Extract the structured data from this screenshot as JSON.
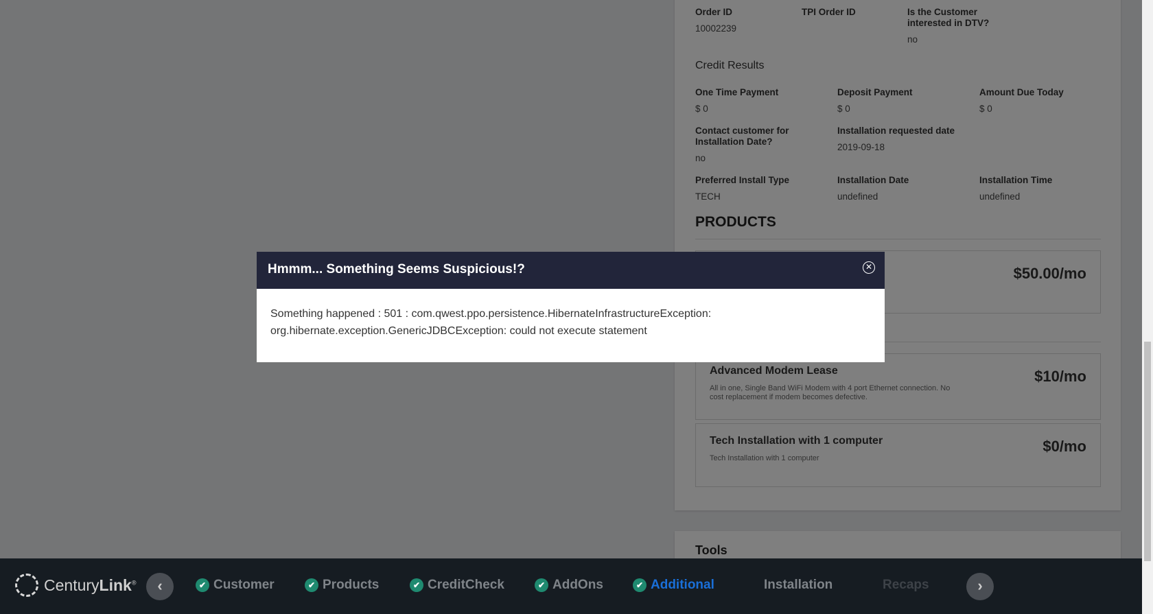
{
  "summary": {
    "order_id": {
      "label": "Order ID",
      "value": "10002239"
    },
    "tpi_order_id": {
      "label": "TPI Order ID",
      "value": ""
    },
    "dtv_interest": {
      "label": "Is the Customer interested in DTV?",
      "value": "no"
    },
    "credit_results_title": "Credit Results",
    "one_time_payment": {
      "label": "One Time Payment",
      "value": "$ 0"
    },
    "deposit_payment": {
      "label": "Deposit Payment",
      "value": "$ 0"
    },
    "amount_due_today": {
      "label": "Amount Due Today",
      "value": "$ 0"
    },
    "contact_customer": {
      "label": "Contact customer for Installation Date?",
      "value": "no"
    },
    "install_requested_date": {
      "label": "Installation requested date",
      "value": "2019-09-18"
    },
    "preferred_install_type": {
      "label": "Preferred Install Type",
      "value": "TECH"
    },
    "installation_date": {
      "label": "Installation Date",
      "value": "undefined"
    },
    "installation_time": {
      "label": "Installation Time",
      "value": "undefined"
    }
  },
  "products": {
    "title": "PRODUCTS",
    "items": [
      {
        "name": "",
        "description": "",
        "price": "$50.00/mo"
      },
      {
        "name": "Advanced Modem Lease",
        "description": "All in one, Single Band WiFi Modem with 4 port Ethernet connection. No cost replacement if modem becomes defective.",
        "price": "$10/mo"
      },
      {
        "name": "Tech Installation with 1 computer",
        "description": "Tech Installation with 1 computer",
        "price": "$0/mo"
      }
    ]
  },
  "tools": {
    "title": "Tools"
  },
  "modal": {
    "title": "Hmmm... Something Seems Suspicious!?",
    "close_icon": "circle-x-icon",
    "line1": "Something happened : 501 : com.qwest.ppo.persistence.HibernateInfrastructureException:",
    "line2": "org.hibernate.exception.GenericJDBCException: could not execute statement"
  },
  "footer": {
    "brand_regular": "Century",
    "brand_bold": "Link",
    "brand_mark": "®",
    "prev_icon": "chevron-left-icon",
    "next_icon": "chevron-right-icon",
    "steps": [
      {
        "label": "Customer",
        "state": "done"
      },
      {
        "label": "Products",
        "state": "done"
      },
      {
        "label": "CreditCheck",
        "state": "done"
      },
      {
        "label": "AddOns",
        "state": "done"
      },
      {
        "label": "Additional",
        "state": "active"
      },
      {
        "label": "Installation",
        "state": "pending"
      },
      {
        "label": "Recaps",
        "state": "disabled"
      }
    ]
  },
  "colors": {
    "active_step": "#1a6fd8",
    "check_badge": "#1f8a70",
    "modal_header": "#22253a",
    "footer_bg": "#161c22"
  }
}
